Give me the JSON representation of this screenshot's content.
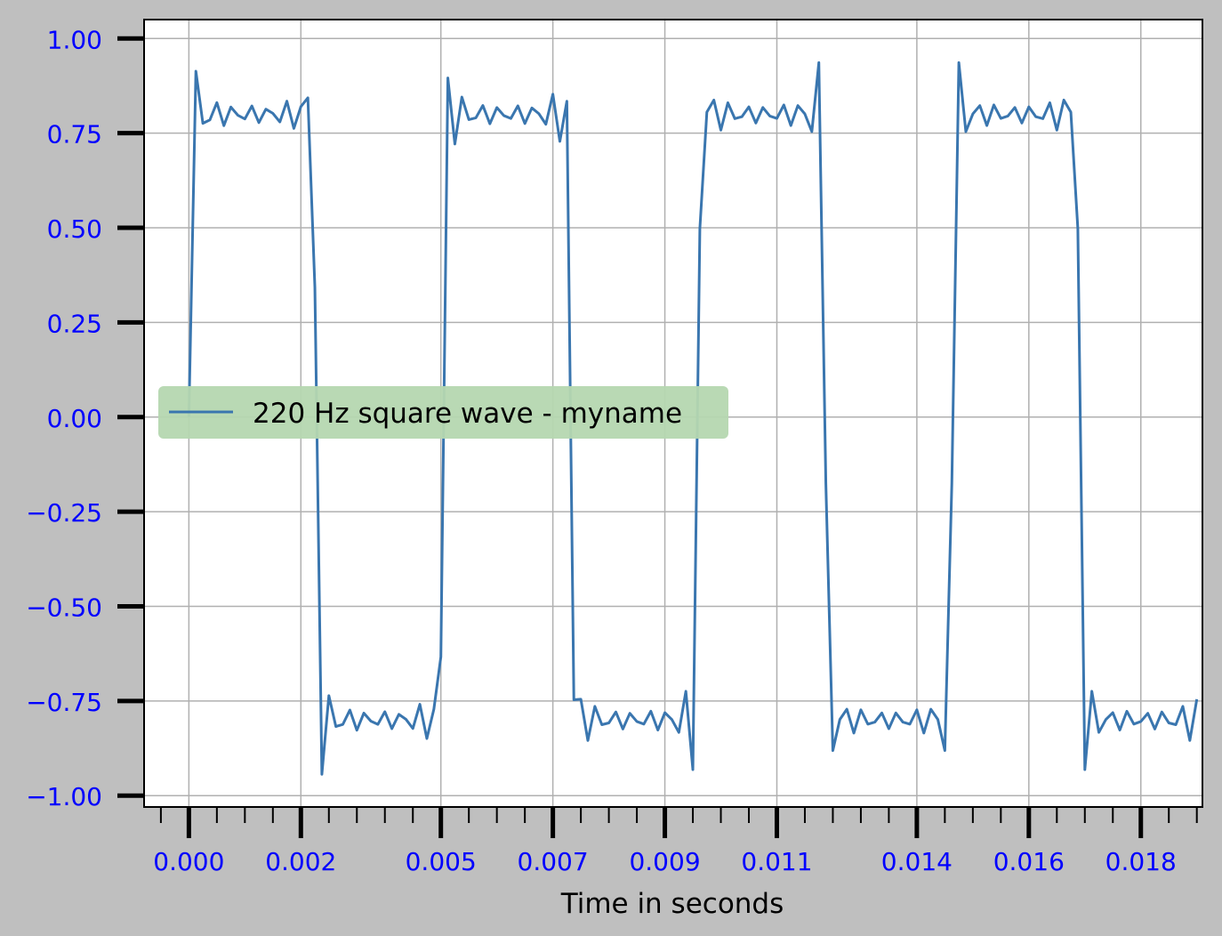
{
  "figure": {
    "background_color": "#bfbfbf",
    "axes_background_color": "#ffffff",
    "tick_label_color": "#0000ff",
    "xlabel_color": "#000000"
  },
  "chart_data": {
    "type": "line",
    "title": "",
    "xlabel": "Time in seconds",
    "ylabel": "",
    "xlim": [
      -0.0008,
      0.0181
    ],
    "ylim": [
      -1.03,
      1.05
    ],
    "grid": true,
    "grid_color": "#b0b0b0",
    "legend_placement": "center-left",
    "legend_background": "#b5d7b0",
    "x_ticks": [
      0.0,
      0.002,
      0.0045,
      0.0065,
      0.0085,
      0.0105,
      0.013,
      0.015,
      0.017
    ],
    "x_tick_labels": [
      "0.000",
      "0.002",
      "0.005",
      "0.007",
      "0.009",
      "0.011",
      "0.014",
      "0.016",
      "0.018"
    ],
    "x_minor_step": 0.0005,
    "y_ticks": [
      1.0,
      0.75,
      0.5,
      0.25,
      0.0,
      -0.25,
      -0.5,
      -0.75,
      -1.0
    ],
    "y_tick_labels": [
      "1.00",
      "0.75",
      "0.50",
      "0.25",
      "0.00",
      "−0.25",
      "−0.50",
      "−0.75",
      "−1.00"
    ],
    "series": [
      {
        "name": "220 Hz square wave - myname",
        "color": "#3a76af",
        "frequency_hz": 220,
        "amplitude": 0.8,
        "harmonics": [
          1,
          3,
          5,
          7,
          9,
          11,
          13,
          15,
          17,
          19,
          21
        ],
        "x_start": 0.0,
        "x_end": 0.02,
        "sample_rate_hz": 8000
      }
    ]
  }
}
